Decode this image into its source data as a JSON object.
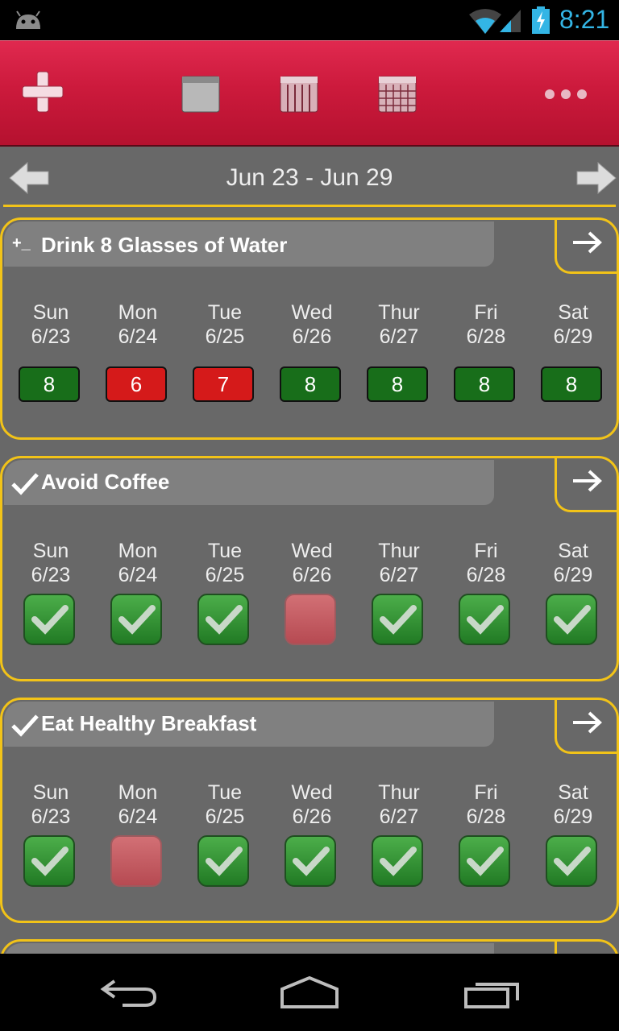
{
  "status_bar": {
    "time": "8:21",
    "icons": [
      "android-icon",
      "wifi-icon",
      "signal-icon",
      "battery-icon"
    ]
  },
  "toolbar": {
    "buttons": [
      "add-icon",
      "day-view-icon",
      "week-view-icon",
      "month-view-icon",
      "more-icon"
    ],
    "accent": "#cc1a3c"
  },
  "date_nav": {
    "range": "Jun 23 - Jun 29"
  },
  "habits": [
    {
      "title": "Drink 8 Glasses of Water",
      "type": "count",
      "icon_text": "+_",
      "days": [
        {
          "name": "Sun",
          "date": "6/23",
          "value": "8",
          "status": "green"
        },
        {
          "name": "Mon",
          "date": "6/24",
          "value": "6",
          "status": "red"
        },
        {
          "name": "Tue",
          "date": "6/25",
          "value": "7",
          "status": "red"
        },
        {
          "name": "Wed",
          "date": "6/26",
          "value": "8",
          "status": "green"
        },
        {
          "name": "Thur",
          "date": "6/27",
          "value": "8",
          "status": "green"
        },
        {
          "name": "Fri",
          "date": "6/28",
          "value": "8",
          "status": "green"
        },
        {
          "name": "Sat",
          "date": "6/29",
          "value": "8",
          "status": "green"
        }
      ]
    },
    {
      "title": "Avoid Coffee",
      "type": "check",
      "days": [
        {
          "name": "Sun",
          "date": "6/23",
          "status": "green"
        },
        {
          "name": "Mon",
          "date": "6/24",
          "status": "green"
        },
        {
          "name": "Tue",
          "date": "6/25",
          "status": "green"
        },
        {
          "name": "Wed",
          "date": "6/26",
          "status": "red"
        },
        {
          "name": "Thur",
          "date": "6/27",
          "status": "green"
        },
        {
          "name": "Fri",
          "date": "6/28",
          "status": "green"
        },
        {
          "name": "Sat",
          "date": "6/29",
          "status": "green"
        }
      ]
    },
    {
      "title": "Eat Healthy Breakfast",
      "type": "check",
      "days": [
        {
          "name": "Sun",
          "date": "6/23",
          "status": "green"
        },
        {
          "name": "Mon",
          "date": "6/24",
          "status": "red"
        },
        {
          "name": "Tue",
          "date": "6/25",
          "status": "green"
        },
        {
          "name": "Wed",
          "date": "6/26",
          "status": "green"
        },
        {
          "name": "Thur",
          "date": "6/27",
          "status": "green"
        },
        {
          "name": "Fri",
          "date": "6/28",
          "status": "green"
        },
        {
          "name": "Sat",
          "date": "6/29",
          "status": "green"
        }
      ]
    }
  ],
  "colors": {
    "border_yellow": "#f2c318",
    "good_green": "#186e1a",
    "bad_red": "#d51a1a",
    "clock_blue": "#33b5e5"
  },
  "nav_bar": {
    "buttons": [
      "back-icon",
      "home-icon",
      "recent-apps-icon"
    ]
  }
}
